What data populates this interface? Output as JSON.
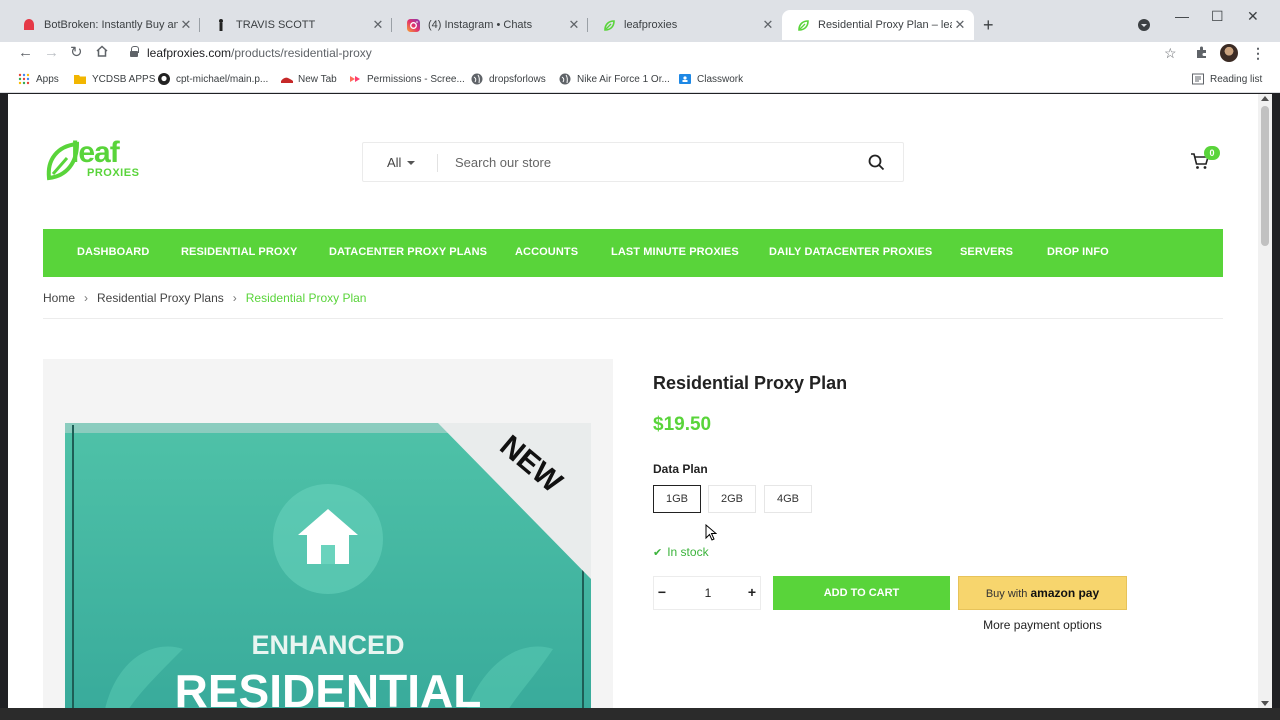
{
  "browser": {
    "tabs": [
      {
        "title": "BotBroken: Instantly Buy and Sell",
        "favicon": "botbroken-icon",
        "active": false
      },
      {
        "title": "TRAVIS SCOTT",
        "favicon": "travis-scott-icon",
        "active": false
      },
      {
        "title": "(4) Instagram • Chats",
        "favicon": "instagram-icon",
        "active": false
      },
      {
        "title": "leafproxies",
        "favicon": "leaf-icon",
        "active": false
      },
      {
        "title": "Residential Proxy Plan – leafproxies",
        "favicon": "leaf-icon",
        "active": true
      }
    ],
    "url_domain": "leafproxies.com",
    "url_path": "/products/residential-proxy",
    "bookmarks": [
      {
        "label": "Apps",
        "icon": "apps-grid-icon"
      },
      {
        "label": "YCDSB APPS",
        "icon": "folder-icon"
      },
      {
        "label": "cpt-michael/main.p...",
        "icon": "github-icon"
      },
      {
        "label": "New Tab",
        "icon": "shoe-icon"
      },
      {
        "label": "Permissions - Scree...",
        "icon": "screencastify-icon"
      },
      {
        "label": "dropsforlows",
        "icon": "globe-icon"
      },
      {
        "label": "Nike Air Force 1 Or...",
        "icon": "globe-icon"
      },
      {
        "label": "Classwork",
        "icon": "classroom-icon"
      }
    ],
    "reading_list": "Reading list"
  },
  "site": {
    "logo_word": "leaf",
    "logo_sub": "PROXIES",
    "search_filter": "All",
    "search_placeholder": "Search our store",
    "cart_count": "0",
    "menu": [
      "DASHBOARD",
      "RESIDENTIAL PROXY",
      "DATACENTER PROXY PLANS",
      "ACCOUNTS",
      "LAST MINUTE PROXIES",
      "DAILY DATACENTER PROXIES",
      "SERVERS",
      "DROP INFO"
    ],
    "accent": "#59d43a"
  },
  "breadcrumb": [
    "Home",
    "Residential Proxy Plans",
    "Residential Proxy Plan"
  ],
  "product": {
    "title": "Residential Proxy Plan",
    "price": "$19.50",
    "option_label": "Data Plan",
    "options": [
      "1GB",
      "2GB",
      "4GB"
    ],
    "selected_option": "1GB",
    "stock": "In stock",
    "quantity": "1",
    "add_to_cart": "ADD TO CART",
    "amazon_prefix": "Buy with",
    "amazon_brand": "amazon pay",
    "more_payment": "More payment options",
    "image": {
      "badge": "NEW",
      "line1": "ENHANCED",
      "line2": "RESIDENTIAL"
    }
  }
}
